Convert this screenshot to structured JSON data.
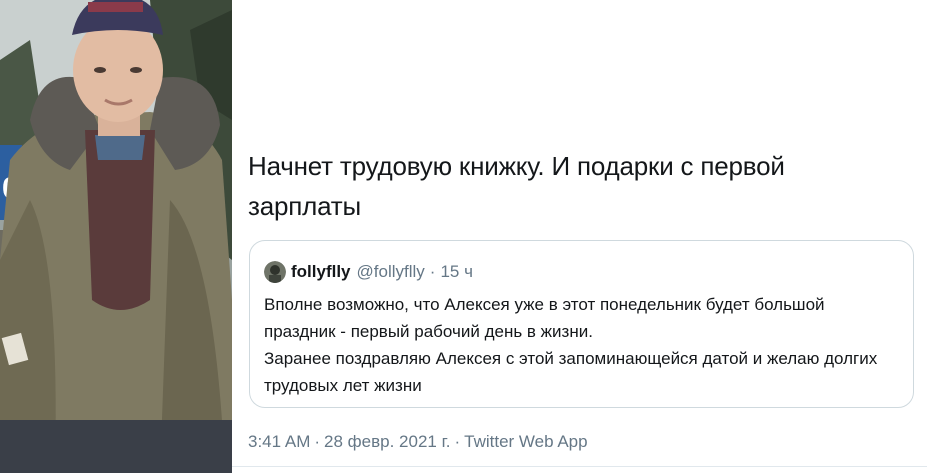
{
  "tweet": {
    "text_line1": "Начнет трудовую книжку. И подарки с первой",
    "text_line2": "зарплаты"
  },
  "quoted": {
    "name": "follyflly",
    "handle": "@follyflly",
    "dot": "·",
    "time": "15 ч",
    "body_line1": "Вполне возможно, что Алексея уже в этот понедельник будет большой",
    "body_line2": "праздник - первый рабочий день в жизни.",
    "body_line3": "Заранее поздравляю Алексея с этой запоминающейся датой и желаю долгих",
    "body_line4": "трудовых лет жизни"
  },
  "meta": {
    "time": "3:41 AM",
    "sep1": "·",
    "date": "28 февр. 2021 г.",
    "sep2": "·",
    "source": "Twitter Web App"
  },
  "colors": {
    "text": "#14171a",
    "secondary": "#657786",
    "border": "#cfd9de"
  }
}
